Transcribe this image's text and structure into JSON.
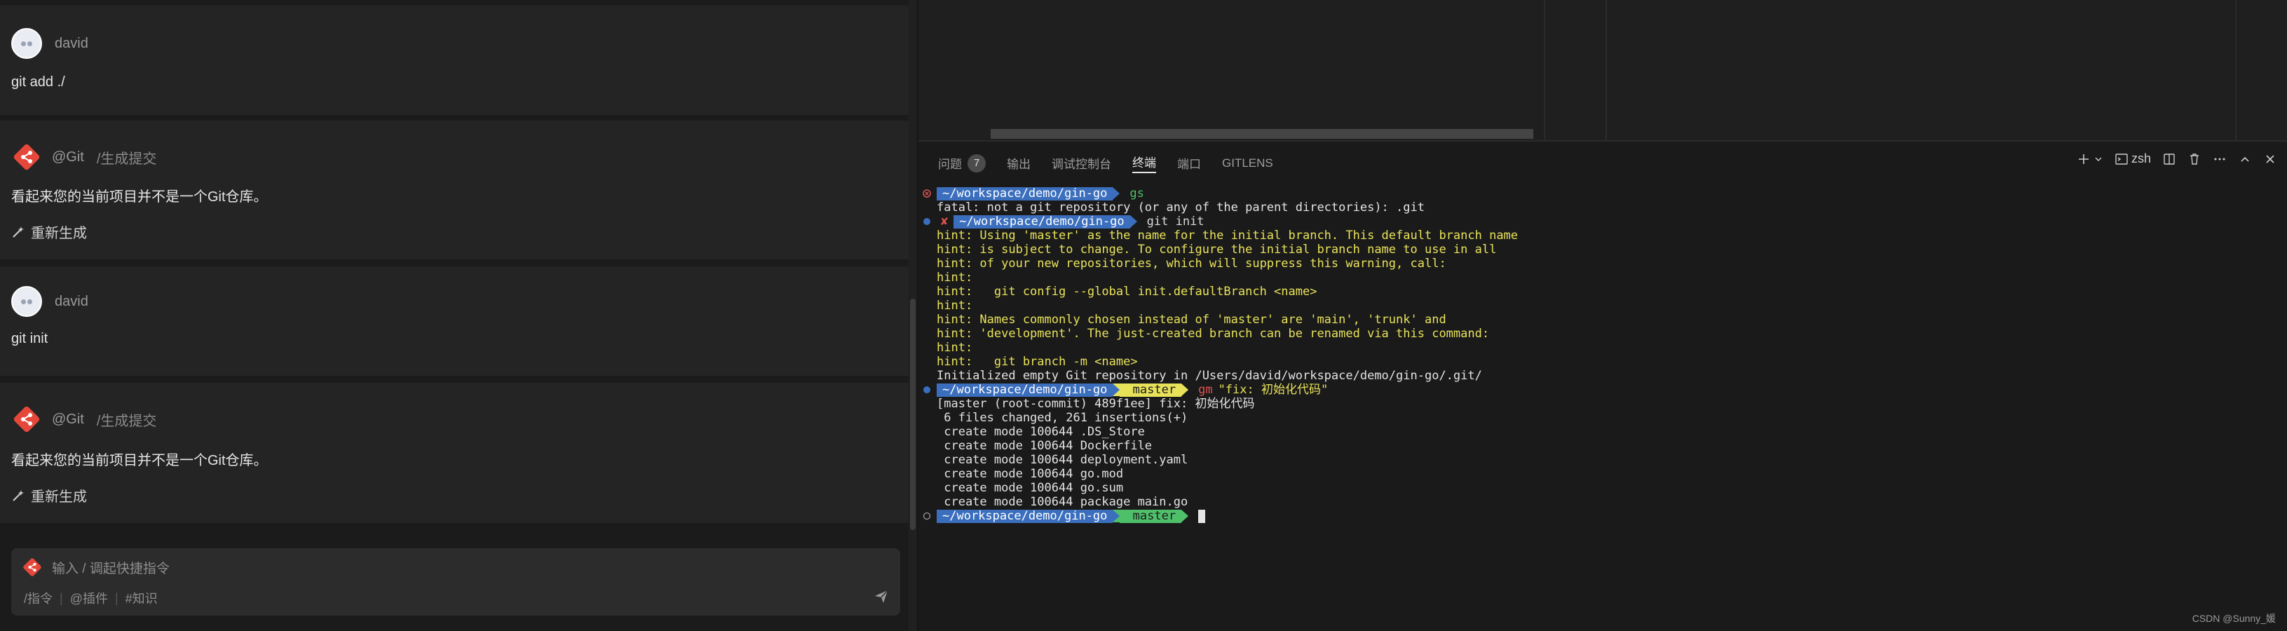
{
  "chat": {
    "messages": [
      {
        "type": "user",
        "name": "david",
        "text": "git add ./"
      },
      {
        "type": "bot",
        "name": "@Git",
        "command": "/生成提交",
        "text": "看起来您的当前项目并不是一个Git仓库。",
        "regen_label": "重新生成"
      },
      {
        "type": "user",
        "name": "david",
        "text": "git init"
      },
      {
        "type": "bot",
        "name": "@Git",
        "command": "/生成提交",
        "text": "看起来您的当前项目并不是一个Git仓库。",
        "regen_label": "重新生成"
      }
    ],
    "input": {
      "placeholder": "输入 / 调起快捷指令",
      "tools": [
        "/指令",
        "@插件",
        "#知识"
      ]
    }
  },
  "panel": {
    "tabs": [
      {
        "label": "问题",
        "badge": "7"
      },
      {
        "label": "输出"
      },
      {
        "label": "调试控制台"
      },
      {
        "label": "终端",
        "active": true
      },
      {
        "label": "端口"
      },
      {
        "label": "GITLENS"
      }
    ],
    "shell_label": "zsh"
  },
  "terminal": {
    "prompt_path": "~/workspace/demo/gin-go",
    "branch": "master",
    "branch_icon": "",
    "cmd1": "gs",
    "cmd1_error": "fatal: not a git repository (or any of the parent directories): .git",
    "cmd2_mark": "✘",
    "cmd2": "git init",
    "hints": [
      "hint: Using 'master' as the name for the initial branch. This default branch name",
      "hint: is subject to change. To configure the initial branch name to use in all",
      "hint: of your new repositories, which will suppress this warning, call:",
      "hint:",
      "hint:   git config --global init.defaultBranch <name>",
      "hint:",
      "hint: Names commonly chosen instead of 'master' are 'main', 'trunk' and",
      "hint: 'development'. The just-created branch can be renamed via this command:",
      "hint:",
      "hint:   git branch -m <name>"
    ],
    "init_output": "Initialized empty Git repository in /Users/david/workspace/demo/gin-go/.git/",
    "cmd3": "gm",
    "cmd3_arg": "\"fix: 初始化代码\"",
    "commit_output": [
      "[master (root-commit) 489f1ee] fix: 初始化代码",
      " 6 files changed, 261 insertions(+)",
      " create mode 100644 .DS_Store",
      " create mode 100644 Dockerfile",
      " create mode 100644 deployment.yaml",
      " create mode 100644 go.mod",
      " create mode 100644 go.sum",
      " create mode 100644 package main.go"
    ]
  },
  "watermark": "CSDN @Sunny_媛"
}
